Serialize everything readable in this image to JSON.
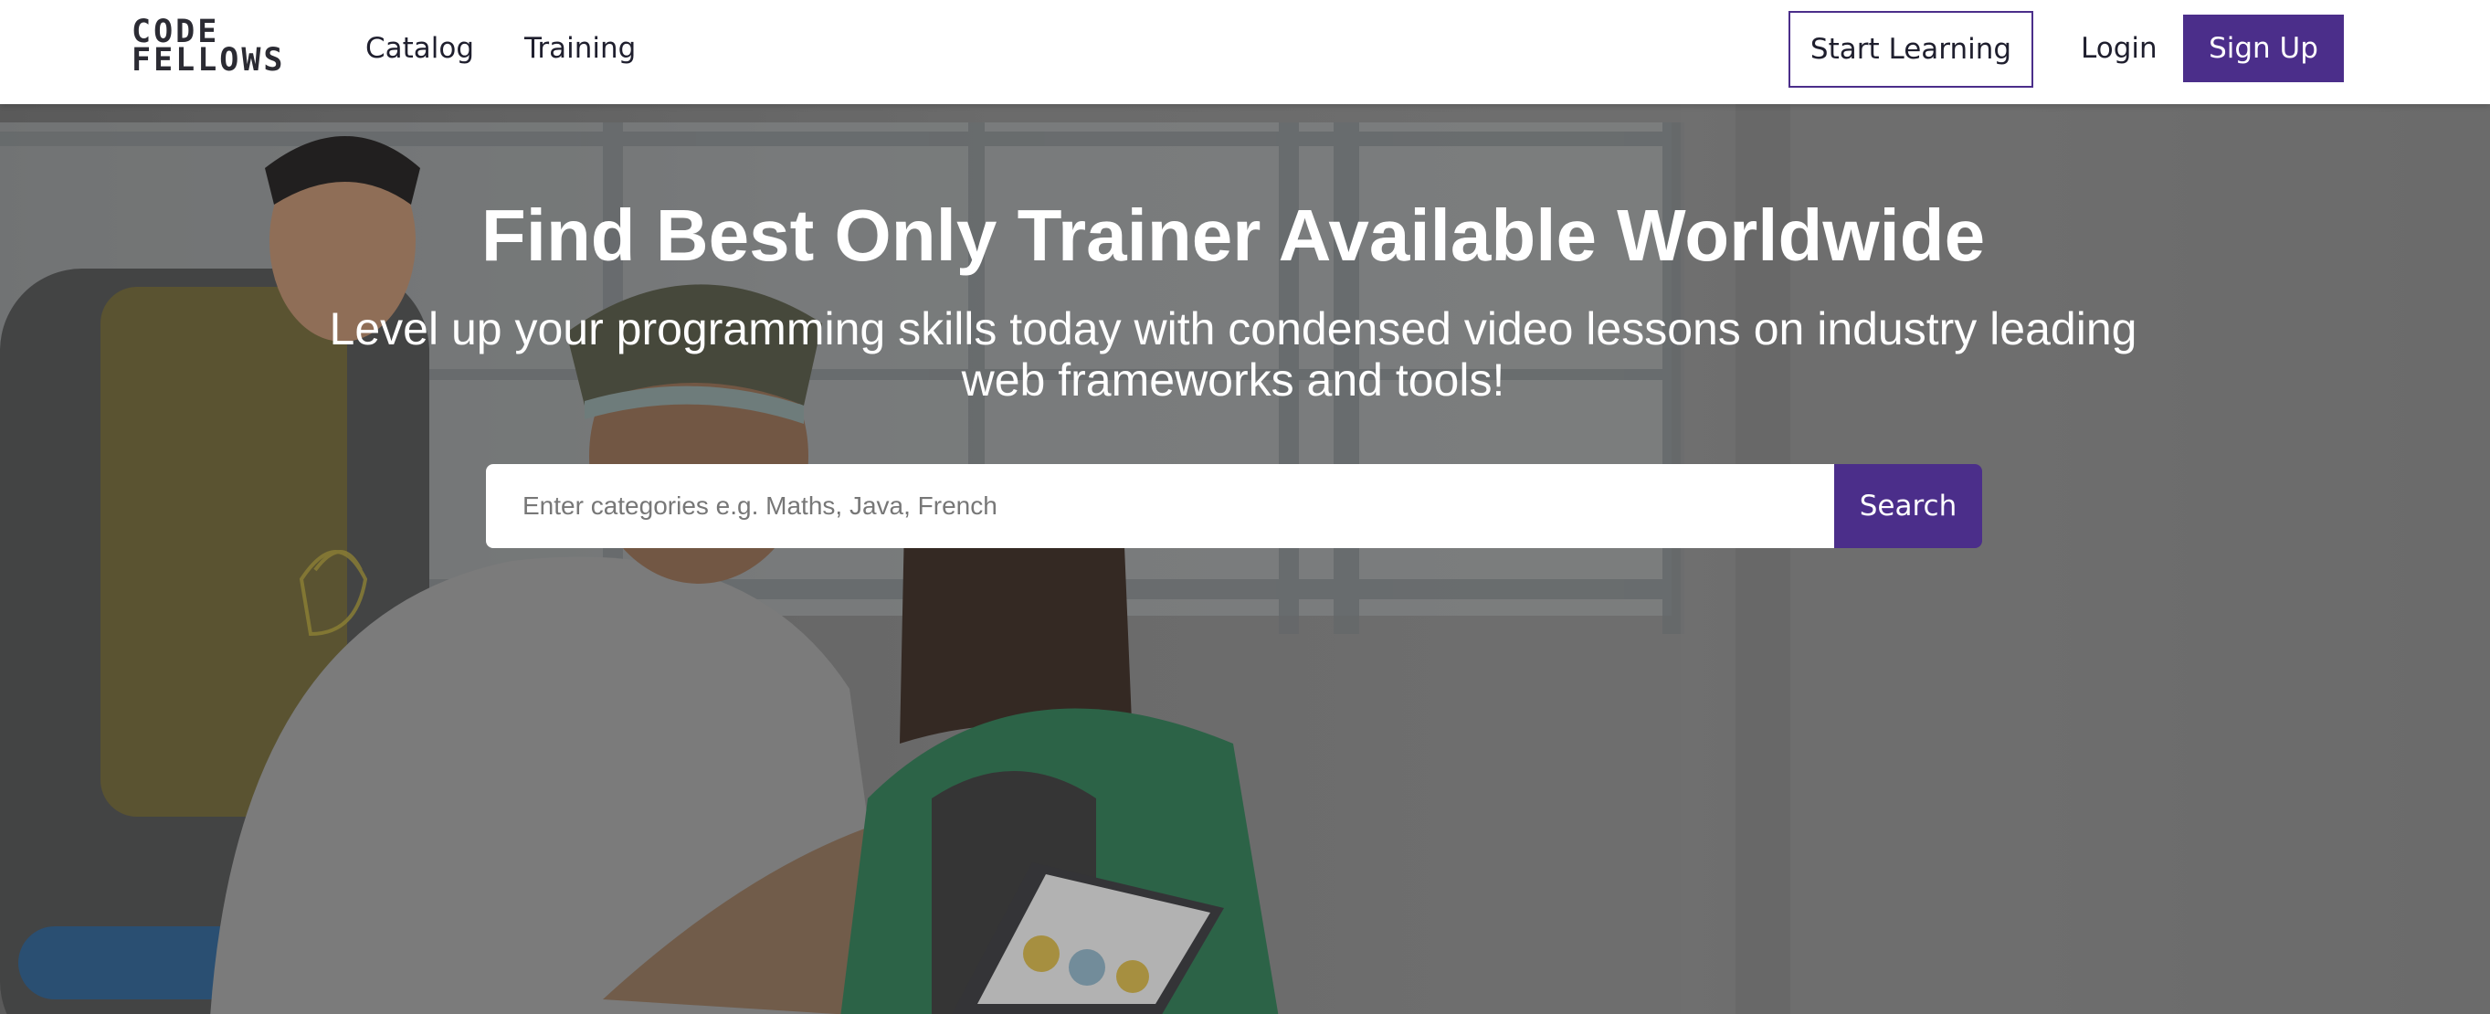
{
  "brand": {
    "logo_line1": "CODE",
    "logo_line2": "FELLOWS"
  },
  "nav": {
    "links": [
      {
        "label": "Catalog"
      },
      {
        "label": "Training"
      }
    ],
    "start_learning": "Start Learning",
    "login": "Login",
    "signup": "Sign Up"
  },
  "hero": {
    "title": "Find Best Only Trainer Available Worldwide",
    "subtitle": "Level up your programming skills today with condensed video lessons on industry leading web frameworks and tools!",
    "search": {
      "placeholder": "Enter categories e.g. Maths, Java, French",
      "value": "",
      "button": "Search"
    }
  },
  "colors": {
    "accent": "#4b2e8a",
    "nav_bg": "#ffffff",
    "hero_text": "#ffffff"
  }
}
